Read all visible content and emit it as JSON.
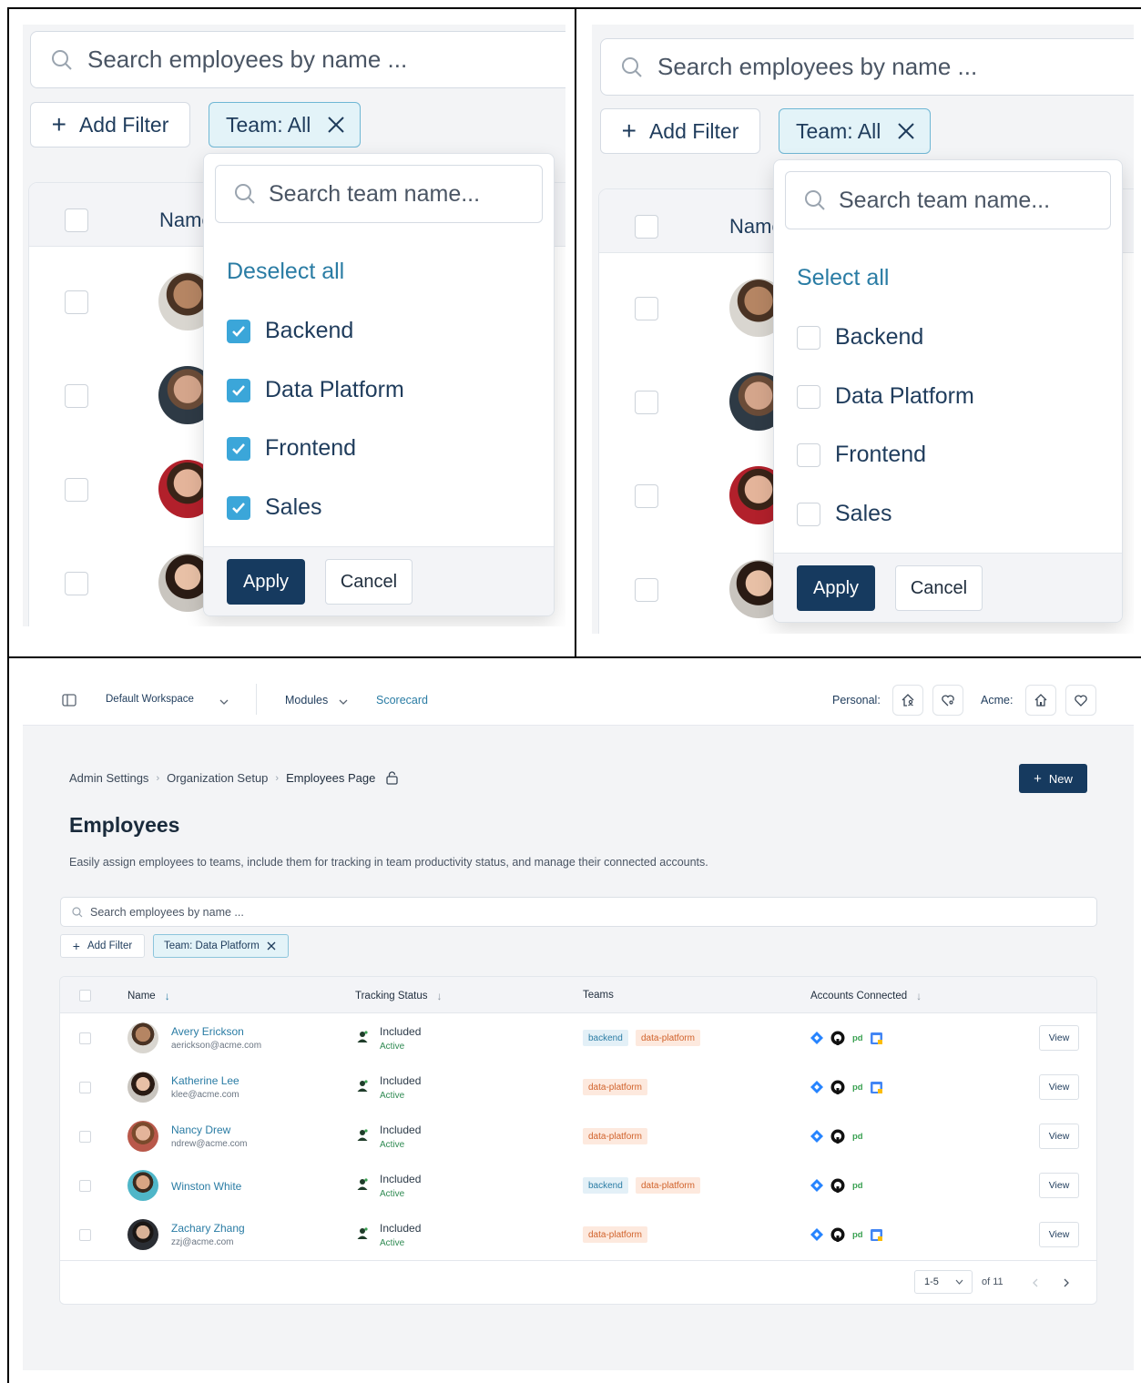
{
  "colors": {
    "primary": "#163a5f",
    "link": "#2a7ca4",
    "checkbox_on": "#3ba6d9",
    "chip_bg": "#e3f3f8",
    "backend_tag": "#e3f0f7",
    "platform_tag": "#fde9de",
    "active_green": "#2f8a52"
  },
  "zoom_left": {
    "search_placeholder": "Search employees by name ...",
    "add_filter": "Add Filter",
    "team_chip": "Team: All",
    "header_name": "Name",
    "popover": {
      "search_placeholder": "Search team name...",
      "toggle_link": "Deselect all",
      "options": [
        {
          "label": "Backend",
          "checked": true
        },
        {
          "label": "Data Platform",
          "checked": true
        },
        {
          "label": "Frontend",
          "checked": true
        },
        {
          "label": "Sales",
          "checked": true
        }
      ],
      "apply": "Apply",
      "cancel": "Cancel"
    }
  },
  "zoom_right": {
    "search_placeholder": "Search employees by name ...",
    "add_filter": "Add Filter",
    "team_chip": "Team: All",
    "header_name": "Name",
    "popover": {
      "search_placeholder": "Search team name...",
      "toggle_link": "Select all",
      "options": [
        {
          "label": "Backend",
          "checked": false
        },
        {
          "label": "Data Platform",
          "checked": false
        },
        {
          "label": "Frontend",
          "checked": false
        },
        {
          "label": "Sales",
          "checked": false
        }
      ],
      "apply": "Apply",
      "cancel": "Cancel"
    }
  },
  "topbar": {
    "workspace": "Default Workspace",
    "modules": "Modules",
    "scorecard": "Scorecard",
    "personal_label": "Personal:",
    "acme_label": "Acme:"
  },
  "page": {
    "breadcrumbs": [
      "Admin Settings",
      "Organization Setup",
      "Employees Page"
    ],
    "new_button": "New",
    "title": "Employees",
    "description": "Easily assign employees to teams, include them for tracking in team productivity status, and manage their connected accounts.",
    "search_placeholder": "Search employees by name ...",
    "add_filter": "Add Filter",
    "team_chip": "Team: Data Platform"
  },
  "table": {
    "headers": {
      "name": "Name",
      "tracking": "Tracking Status",
      "teams": "Teams",
      "accounts": "Accounts Connected"
    },
    "rows": [
      {
        "name": "Avery Erickson",
        "email": "aerickson@acme.com",
        "status": "Included",
        "state": "Active",
        "teams": [
          "backend",
          "data-platform"
        ],
        "accounts": [
          "jira",
          "github",
          "pd",
          "calendar"
        ],
        "view": "View"
      },
      {
        "name": "Katherine Lee",
        "email": "klee@acme.com",
        "status": "Included",
        "state": "Active",
        "teams": [
          "data-platform"
        ],
        "accounts": [
          "jira",
          "github",
          "pd",
          "calendar"
        ],
        "view": "View"
      },
      {
        "name": "Nancy Drew",
        "email": "ndrew@acme.com",
        "status": "Included",
        "state": "Active",
        "teams": [
          "data-platform"
        ],
        "accounts": [
          "jira",
          "github",
          "pd"
        ],
        "view": "View"
      },
      {
        "name": "Winston White",
        "email": "",
        "status": "Included",
        "state": "Active",
        "teams": [
          "backend",
          "data-platform"
        ],
        "accounts": [
          "jira",
          "github",
          "pd"
        ],
        "view": "View"
      },
      {
        "name": "Zachary Zhang",
        "email": "zzj@acme.com",
        "status": "Included",
        "state": "Active",
        "teams": [
          "data-platform"
        ],
        "accounts": [
          "jira",
          "github",
          "pd",
          "calendar"
        ],
        "view": "View"
      }
    ],
    "pager": {
      "range": "1-5",
      "total": "of 11"
    }
  }
}
